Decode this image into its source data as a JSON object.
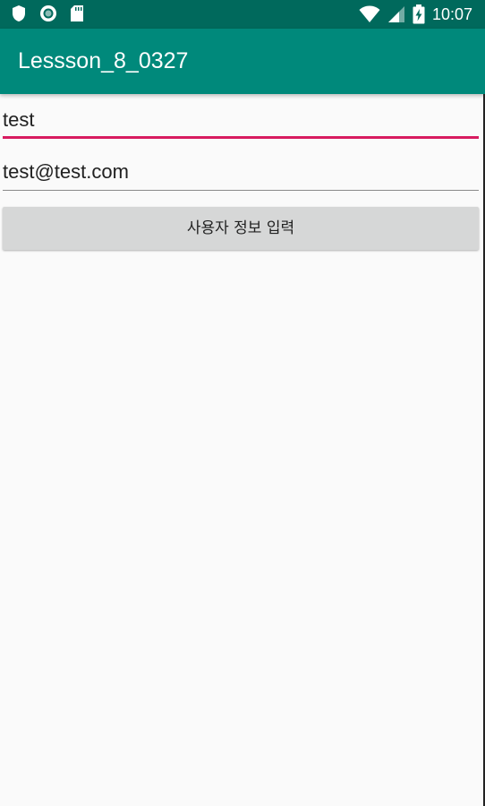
{
  "status_bar": {
    "time": "10:07",
    "left_icons": [
      "shield-icon",
      "record-icon",
      "sd-card-icon"
    ],
    "right_icons": [
      "wifi-icon",
      "signal-icon",
      "battery-charging-icon"
    ]
  },
  "app_bar": {
    "title": "Lessson_8_0327"
  },
  "form": {
    "name_field": {
      "value": "test"
    },
    "email_field": {
      "value": "test@test.com"
    },
    "submit_label": "사용자 정보 입력"
  },
  "colors": {
    "status_bar": "#00695c",
    "app_bar": "#00897b",
    "focus_accent": "#d81b60",
    "button_bg": "#d6d7d7",
    "background": "#fafafa"
  }
}
